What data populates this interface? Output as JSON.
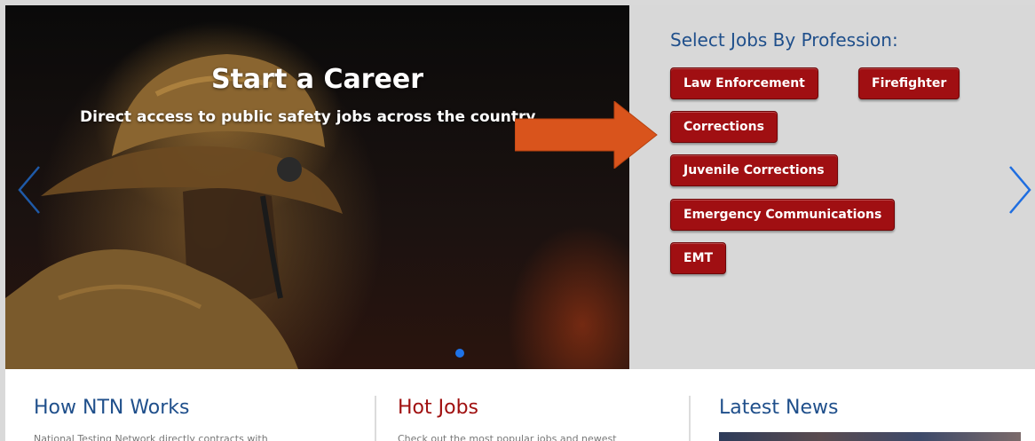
{
  "hero": {
    "title": "Start a Career",
    "subtitle": "Direct access to public safety jobs across the country"
  },
  "professions": {
    "title": "Select Jobs By Profession:",
    "buttons": [
      "Law Enforcement",
      "Firefighter",
      "Corrections",
      "Juvenile Corrections",
      "Emergency Communications",
      "EMT"
    ]
  },
  "slider": {
    "prev_icon": "chevron-left-icon",
    "next_icon": "chevron-right-icon",
    "active_dot": 1
  },
  "columns": [
    {
      "title": "How NTN Works",
      "text": "National Testing Network directly contracts with"
    },
    {
      "title": "Hot Jobs",
      "text": "Check out the most popular jobs and newest"
    },
    {
      "title": "Latest News",
      "text": ""
    }
  ],
  "colors": {
    "button_red": "#a00f12",
    "panel_gray": "#d8d8d8",
    "link_blue": "#1f4f8b",
    "hot_jobs_red": "#a01010",
    "callout_orange": "#d9541c",
    "dot_blue": "#1e73e8"
  }
}
